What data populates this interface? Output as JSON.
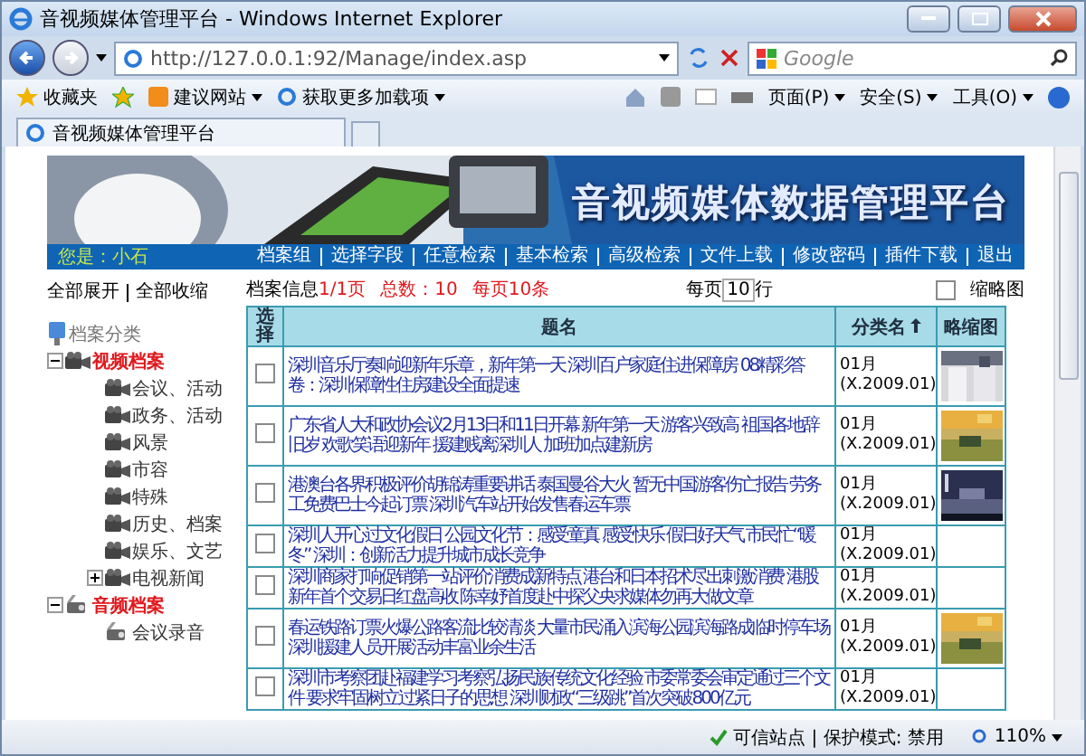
{
  "window": {
    "title": "音视频媒体管理平台 - Windows Internet Explorer"
  },
  "address_bar": {
    "value": "http://127.0.0.1:92/Manage/index.asp"
  },
  "search": {
    "placeholder": "Google"
  },
  "favorites_bar": {
    "favorites": "收藏夹",
    "links": [
      {
        "label": "建议网站",
        "kind": "site"
      },
      {
        "label": "获取更多加载项",
        "kind": "addon"
      }
    ]
  },
  "command_bar": [
    "页面(P)",
    "安全(S)",
    "工具(O)"
  ],
  "tab": {
    "label": "音视频媒体管理平台"
  },
  "banner": {
    "title": "音视频媒体数据管理平台"
  },
  "nav": {
    "user": "您是：小石",
    "links": [
      "档案组",
      "选择字段",
      "任意检索",
      "基本检索",
      "高级检索",
      "文件上载",
      "修改密码",
      "插件下载",
      "退出"
    ]
  },
  "tree_controls": [
    "全部展开",
    "全部收缩"
  ],
  "tree": {
    "label": "档案分类",
    "children": [
      {
        "label": "视频档案",
        "kind": "video",
        "expanded": true,
        "children": [
          {
            "label": "会议、活动",
            "kind": "video"
          },
          {
            "label": "政务、活动",
            "kind": "video"
          },
          {
            "label": "风景",
            "kind": "video"
          },
          {
            "label": "市容",
            "kind": "video"
          },
          {
            "label": "特殊",
            "kind": "video"
          },
          {
            "label": "历史、档案",
            "kind": "video"
          },
          {
            "label": "娱乐、文艺",
            "kind": "video"
          },
          {
            "label": "电视新闻",
            "kind": "video",
            "expanded": false
          }
        ]
      },
      {
        "label": "音频档案",
        "kind": "audio",
        "expanded": true,
        "children": [
          {
            "label": "会议录音",
            "kind": "audio"
          }
        ]
      }
    ]
  },
  "info": {
    "label": "档案信息",
    "pages": "1/1页",
    "total": "总数：10",
    "per_page_note": "每页10条",
    "per_page_label": "每页",
    "per_page_value": "10",
    "per_page_unit": "行",
    "thumbnail_toggle": {
      "label": "缩略图",
      "checked": false
    }
  },
  "table": {
    "columns": [
      "选择",
      "题名",
      "分类名",
      "略缩图"
    ],
    "rows": [
      {
        "checked": false,
        "title": "深圳音乐厅奏响迎新年乐章，新年第一天 深圳百户家庭住进保障房 08精彩答卷：深圳保障性住房建设全面提速",
        "category": "01月",
        "code": "(X.2009.01)",
        "thumbnail": true
      },
      {
        "checked": false,
        "title": "广东省人大和政协会议2月13日和11日开幕 新年第一天 游客兴致高 祖国各地辞旧岁 欢歌笑语迎新年 援建贱离深圳人 加班加点建新房",
        "category": "01月",
        "code": "(X.2009.01)",
        "thumbnail": true
      },
      {
        "checked": false,
        "title": "港澳台各界积极评价胡锦涛重要讲话 泰国曼谷大火 暂无中国游客伤亡报告 劳务工免费巴士今起订票 深圳汽车站开始发售春运车票",
        "category": "01月",
        "code": "(X.2009.01)",
        "thumbnail": true
      },
      {
        "checked": false,
        "title": "深圳人开心过文化假日 公园文化节：感受童真 感受快乐 假日好天气 市民忙“暖冬” 深圳：创新活力提升城市成长竞争",
        "category": "01月",
        "code": "(X.2009.01)",
        "thumbnail": false
      },
      {
        "checked": false,
        "title": "深圳商家打响促销第一站评价消费成新特点 港台和日本招术尽出刺激消费 港股新年首个交易日红盘高收 陈幸妤首度赴中探父央求媒体勿再大做文章",
        "category": "01月",
        "code": "(X.2009.01)",
        "thumbnail": false
      },
      {
        "checked": false,
        "title": "春运铁路订票火爆公路客流比较清淡 大量市民涌入滨海公园滨海路成临时停车场深圳援建人员开展活动丰富业余生活",
        "category": "01月",
        "code": "(X.2009.01)",
        "thumbnail": true
      },
      {
        "checked": false,
        "title": "深圳市考察团赴福建学习考察弘扬民族传统文化经验 市委常委会审定通过三个文件 要求牢固树立过紧日子的思想 深圳财政“三级跳”首次突破800亿元",
        "category": "01月",
        "code": "(X.2009.01)",
        "thumbnail": false
      }
    ]
  },
  "status_bar": {
    "zone": "可信站点 | 保护模式: 禁用",
    "zoom": "110%"
  }
}
